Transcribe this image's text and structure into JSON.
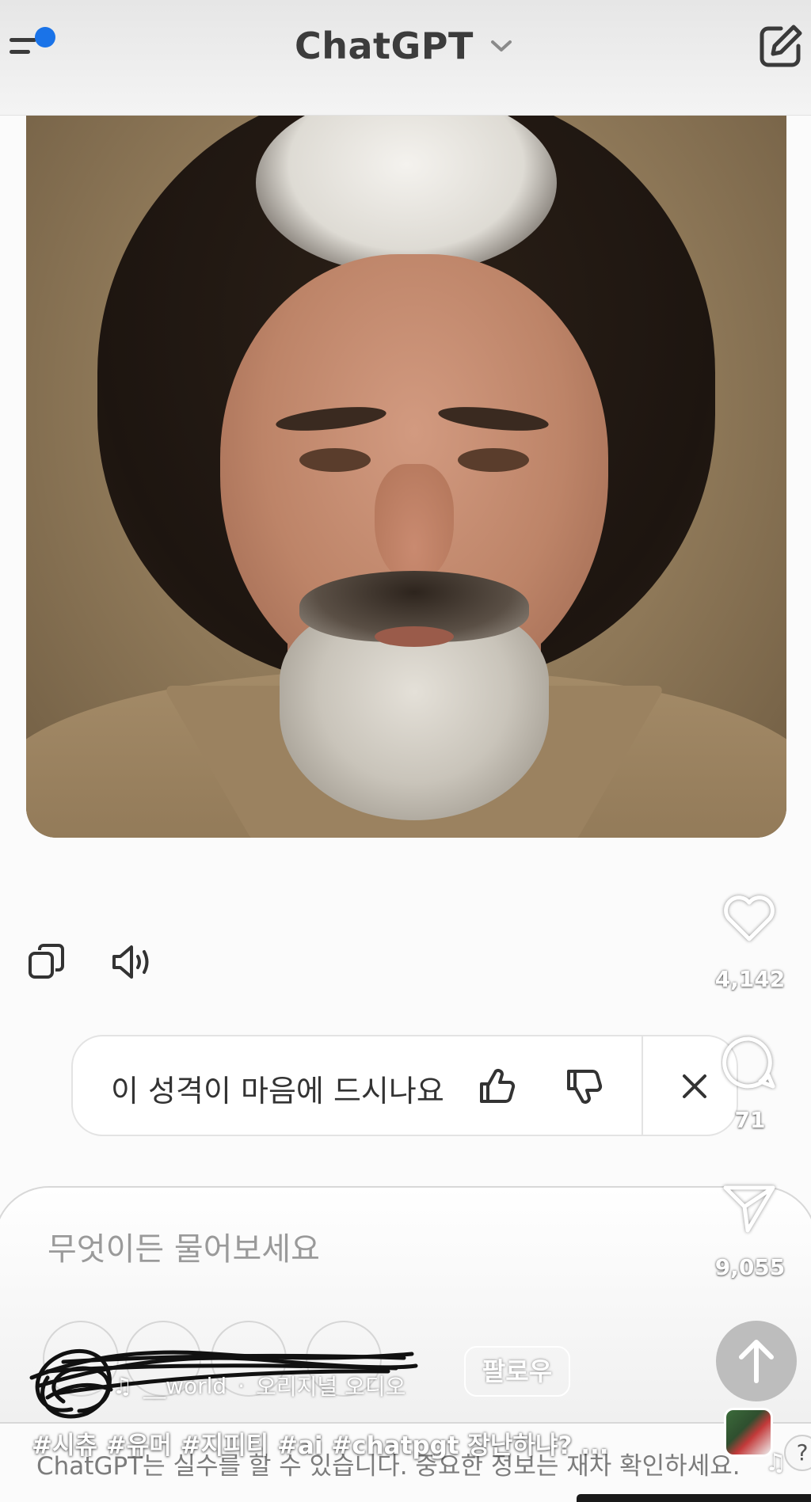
{
  "header": {
    "title": "ChatGPT",
    "menu_icon": "sidebar-menu-icon",
    "notification_color": "#1a73e8",
    "chevron_icon": "chevron-down-icon",
    "new_chat_icon": "edit-icon"
  },
  "message": {
    "image_subject": "generated-portrait-image",
    "actions": {
      "copy_icon": "copy-icon",
      "read_aloud_icon": "speaker-icon"
    }
  },
  "feedback": {
    "question": "이 성격이 마음에 드시나요",
    "thumbs_up_icon": "thumbs-up-icon",
    "thumbs_down_icon": "thumbs-down-icon",
    "close_icon": "close-icon"
  },
  "composer": {
    "placeholder": "무엇이든 물어보세요",
    "disclaimer": "ChatGPT는 실수를 할 수 있습니다. 중요한 정보는 재차 확인하세요.",
    "send_icon": "arrow-up-icon"
  },
  "reel": {
    "likes": "4,142",
    "comments": "71",
    "shares": "9,055",
    "follow_label": "팔로우",
    "audio_user": "__world",
    "audio_separator": "·",
    "audio_label": "오리지널 오디오",
    "caption": "#시츄 #유머 #지피티 #ai #chatpgt 장난하냐? ...",
    "help_label": "?"
  }
}
